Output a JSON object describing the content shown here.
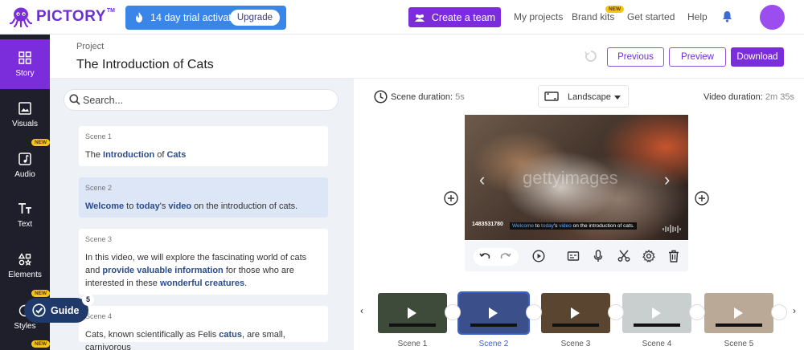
{
  "brand": {
    "name": "PICTORY",
    "tm": "TM"
  },
  "trial": {
    "message": "14 day trial activated!",
    "upgrade_label": "Upgrade"
  },
  "nav": {
    "create_team": "Create a team",
    "my_projects": "My projects",
    "brand_kits": "Brand kits",
    "brand_kits_badge": "NEW",
    "get_started": "Get started",
    "help": "Help"
  },
  "sidebar": {
    "items": [
      {
        "label": "Story"
      },
      {
        "label": "Visuals"
      },
      {
        "label": "Audio",
        "badge": "NEW"
      },
      {
        "label": "Text"
      },
      {
        "label": "Elements"
      },
      {
        "label": "Styles",
        "badge": "NEW"
      }
    ],
    "extra_badge": "NEW"
  },
  "project": {
    "label": "Project",
    "title": "The Introduction of Cats",
    "previous": "Previous",
    "preview": "Preview",
    "download": "Download"
  },
  "search": {
    "placeholder": "Search..."
  },
  "scenes": [
    {
      "num": "Scene 1",
      "parts": [
        [
          "The ",
          false
        ],
        [
          "Introduction",
          true
        ],
        [
          " of ",
          false
        ],
        [
          "Cats",
          true
        ]
      ]
    },
    {
      "num": "Scene 2",
      "parts": [
        [
          "Welcome",
          true
        ],
        [
          " to ",
          false
        ],
        [
          "today",
          true
        ],
        [
          "'s ",
          false
        ],
        [
          "video",
          true
        ],
        [
          " on the introduction of cats.",
          false
        ]
      ]
    },
    {
      "num": "Scene 3",
      "parts": [
        [
          "In this video, we will explore the fascinating world of cats and ",
          false
        ],
        [
          "provide valuable information",
          true
        ],
        [
          " for those who are interested in these ",
          false
        ],
        [
          "wonderful creatures",
          true
        ],
        [
          ".",
          false
        ]
      ]
    },
    {
      "num": "Scene 4",
      "parts": [
        [
          "Cats, known scientifically as Felis ",
          false
        ],
        [
          "catus",
          true
        ],
        [
          ", are small, carnivorous",
          false
        ]
      ]
    }
  ],
  "editor": {
    "scene_duration_label": "Scene duration:",
    "scene_duration_value": "5s",
    "layout": "Landscape",
    "video_duration_label": "Video duration:",
    "video_duration_value": "2m 35s",
    "watermark": "gettyimages",
    "image_id": "1483531780",
    "caption_parts": [
      [
        "Welcome",
        true
      ],
      [
        " to ",
        false
      ],
      [
        "today",
        true
      ],
      [
        "'s ",
        false
      ],
      [
        "video",
        true
      ],
      [
        " on the introduction of cats.",
        false
      ]
    ]
  },
  "timeline": {
    "thumbs": [
      {
        "label": "Scene 1",
        "color": "#3e4a3a"
      },
      {
        "label": "Scene 2",
        "color": "#3b4f8a"
      },
      {
        "label": "Scene 3",
        "color": "#5a4630"
      },
      {
        "label": "Scene 4",
        "color": "#c9cfcf"
      },
      {
        "label": "Scene 5",
        "color": "#b9a996"
      }
    ]
  },
  "guide": {
    "label": "Guide",
    "count": "5"
  },
  "colors": {
    "accent": "#7b2ddb",
    "trial": "#3a86e8",
    "sidebar": "#1f1f2b",
    "highlight": "#2b4d8c"
  }
}
